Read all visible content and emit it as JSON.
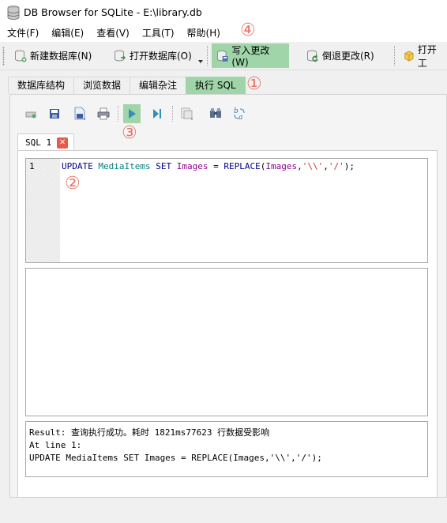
{
  "window": {
    "title": "DB Browser for SQLite - E:\\library.db"
  },
  "menu": [
    "文件(F)",
    "编辑(E)",
    "查看(V)",
    "工具(T)",
    "帮助(H)"
  ],
  "toolbar": {
    "new_db": "新建数据库(N)",
    "open_db": "打开数据库(O)",
    "write_changes": "写入更改(W)",
    "revert_changes": "倒退更改(R)",
    "open_project": "打开工"
  },
  "tabs": [
    "数据库结构",
    "浏览数据",
    "编辑杂注",
    "执行 SQL"
  ],
  "editor": {
    "tab_label": "SQL 1",
    "close_glyph": "✕",
    "line_number": "1",
    "tokens": {
      "update": "UPDATE",
      "table": "MediaItems",
      "set": "SET",
      "column": "Images",
      "eq": " = ",
      "replace": "REPLACE",
      "open": "(",
      "arg_col": "Images",
      "comma1": ",",
      "str1": "'\\\\'",
      "comma2": ",",
      "str2": "'/'",
      "close": ");"
    }
  },
  "messages": {
    "line1": "Result: 查询执行成功。耗时 1821ms77623 行数据受影响",
    "line2": "At line 1:",
    "line3": "UPDATE MediaItems SET Images = REPLACE(Images,'\\\\','/');"
  },
  "annotations": [
    "①",
    "②",
    "③",
    "④"
  ],
  "colors": {
    "highlight": "#9fd5a8",
    "annotation": "#e8756a",
    "close": "#e65c4b"
  }
}
